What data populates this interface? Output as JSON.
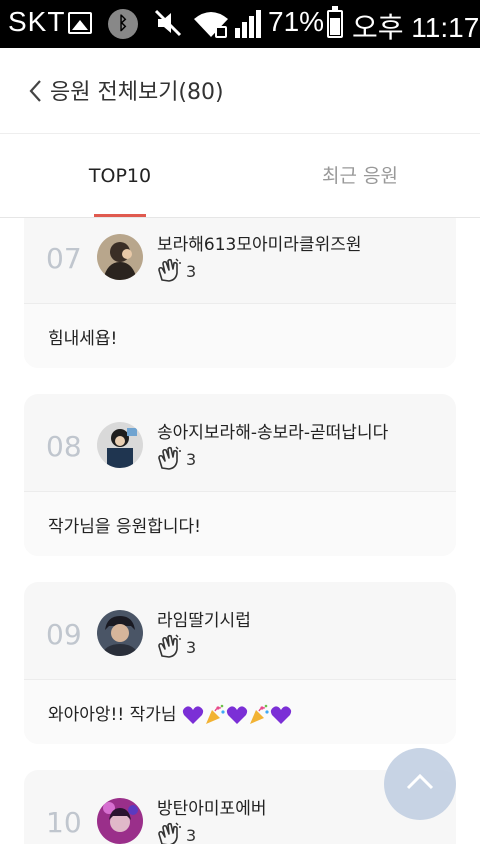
{
  "status_bar": {
    "carrier": "SKT",
    "battery": "71%",
    "battery_level": 0.71,
    "time": "오후 11:17",
    "icons": [
      "image-icon",
      "bluetooth-icon",
      "mute-icon",
      "wifi-icon",
      "signal-icon",
      "battery-icon"
    ]
  },
  "header": {
    "title": "응원 전체보기(80)",
    "back_icon": "chevron-left-icon"
  },
  "tabs": [
    {
      "label": "TOP10",
      "active": true
    },
    {
      "label": "최근 응원",
      "active": false
    }
  ],
  "colors": {
    "accent": "#e05a4f",
    "rank": "#c0c6ce",
    "card_bg": "#f7f7f7",
    "heart": "#7b2fd6"
  },
  "cheers": [
    {
      "rank": "07",
      "nickname": "보라해613모아미라클위즈원",
      "claps": "3",
      "message": "힘내세욥!"
    },
    {
      "rank": "08",
      "nickname": "송아지보라해-송보라-곧떠납니다",
      "claps": "3",
      "message": "작가님을 응원합니다!"
    },
    {
      "rank": "09",
      "nickname": "라임딸기시럽",
      "claps": "3",
      "message": "와아아앙!! 작가님"
    },
    {
      "rank": "10",
      "nickname": "방탄아미포에버",
      "claps": "3",
      "message": ""
    }
  ],
  "fab": {
    "icon": "chevron-up-icon"
  }
}
